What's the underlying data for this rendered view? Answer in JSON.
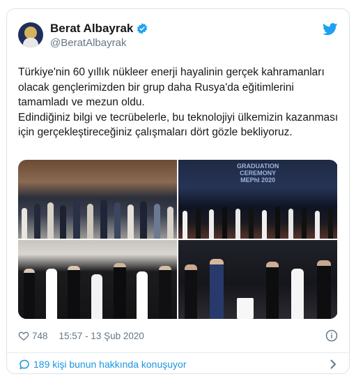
{
  "tweet": {
    "author_name": "Berat Albayrak",
    "author_handle": "@BeratAlbayrak",
    "paragraphs": [
      "Türkiye'nin 60 yıllık nükleer enerji hayalinin gerçek kahramanları olacak gençlerimizden bir grup daha Rusya'da eğitimlerini tamamladı ve mezun oldu.",
      "Edindiğiniz bilgi ve tecrübelerle, bu teknolojiyi ülkemizin kazanması için gerçekleştireceğiniz çalışmaları dört gözle bekliyoruz."
    ],
    "photo_caption_line1": "GRADUATION",
    "photo_caption_line2": "CEREMONY",
    "photo_caption_line3": "MEPhI 2020",
    "likes": "748",
    "timestamp": "15:57 - 13 Şub 2020",
    "conversation_text": "189 kişi bunun hakkında konuşuyor"
  },
  "colors": {
    "accent": "#1da1f2",
    "text": "#14171a",
    "secondary": "#657786"
  },
  "icons": [
    "verified-badge-icon",
    "twitter-bird-icon",
    "heart-icon",
    "info-icon",
    "comment-bubble-icon",
    "chevron-right-icon"
  ]
}
